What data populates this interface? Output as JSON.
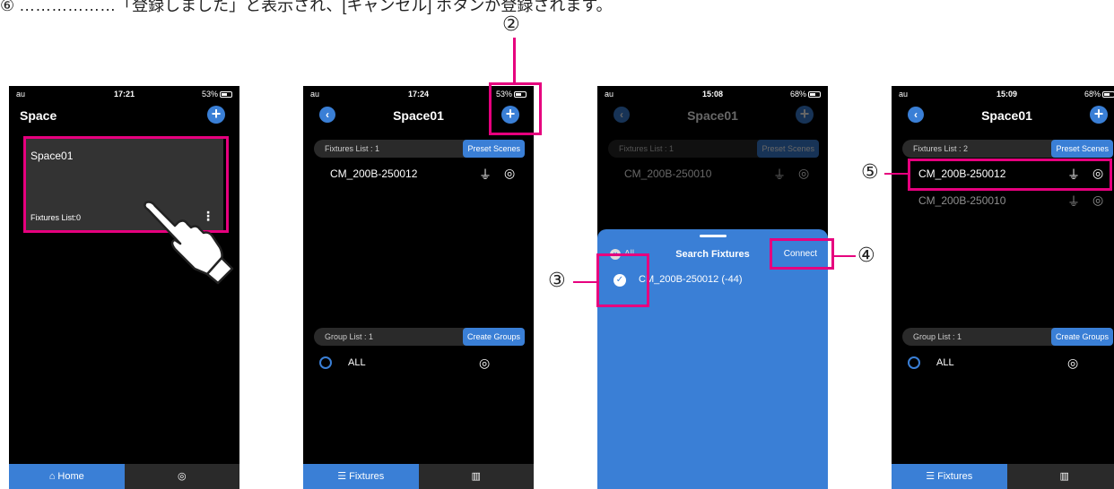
{
  "note": "⑥ ………………「登録しました」と表示され、[キャンセル] ボタンが登録されます。",
  "screens": [
    {
      "status": {
        "carrier": "au",
        "time": "17:21",
        "battery": "53%"
      },
      "title": "Space",
      "card": {
        "name": "Space01",
        "fixtures": "Fixtures List:0"
      },
      "tabs": [
        "Home",
        ""
      ]
    },
    {
      "status": {
        "carrier": "au",
        "time": "17:24",
        "battery": "53%"
      },
      "title": "Space01",
      "fixtures_label": "Fixtures List : 1",
      "preset_btn": "Preset Scenes",
      "fixtures": [
        "CM_200B-250012"
      ],
      "group_label": "Group List : 1",
      "create_btn": "Create Groups",
      "group_all": "ALL",
      "tabs": [
        "Fixtures",
        ""
      ]
    },
    {
      "status": {
        "carrier": "au",
        "time": "15:08",
        "battery": "68%"
      },
      "title": "Space01",
      "fixtures_label": "Fixtures List : 1",
      "preset_btn": "Preset Scenes",
      "fixtures": [
        "CM_200B-250010"
      ],
      "sheet": {
        "all": "All",
        "title": "Search Fixtures",
        "connect": "Connect",
        "item": "CM_200B-250012  (-44)"
      }
    },
    {
      "status": {
        "carrier": "au",
        "time": "15:09",
        "battery": "68%"
      },
      "title": "Space01",
      "fixtures_label": "Fixtures List : 2",
      "preset_btn": "Preset Scenes",
      "fixtures": [
        "CM_200B-250012",
        "CM_200B-250010"
      ],
      "group_label": "Group List : 1",
      "create_btn": "Create Groups",
      "group_all": "ALL",
      "tabs": [
        "Fixtures",
        ""
      ]
    }
  ],
  "callouts": {
    "c2": "②",
    "c3": "③",
    "c4": "④",
    "c5": "⑤"
  },
  "colors": {
    "accent": "#3a7fd6",
    "highlight": "#e6007e"
  }
}
